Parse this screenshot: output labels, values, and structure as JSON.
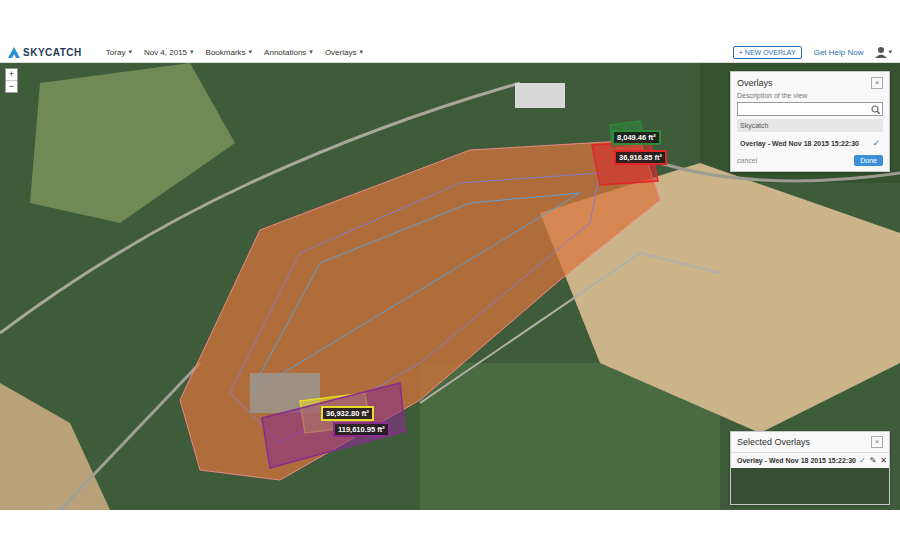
{
  "app": {
    "logo": "SKYCATCH"
  },
  "caret": "▾",
  "menu": [
    {
      "label": "Toray"
    },
    {
      "label": "Nov 4, 2015"
    },
    {
      "label": "Bookmarks"
    },
    {
      "label": "Annotations"
    },
    {
      "label": "Overlays"
    }
  ],
  "header_right": {
    "new_overlay": "+ NEW OVERLAY",
    "help": "Get Help Now"
  },
  "zoom": [
    "+",
    "−"
  ],
  "overlays_panel": {
    "title": "Overlays",
    "subtitle": "Description of the view",
    "close": "×",
    "group": "Skycatch",
    "items": [
      {
        "label": "Overlay - Wed Nov 18 2015 15:22:30",
        "selected": true
      }
    ],
    "check": "✓",
    "cancel": "cancel",
    "done": "Done"
  },
  "selected_panel": {
    "title": "Selected Overlays",
    "close": "×",
    "items": [
      {
        "label": "Overlay - Wed Nov 18 2015 15:22:30",
        "actions": [
          "✓",
          "✎",
          "✕"
        ]
      }
    ]
  },
  "annotations": [
    {
      "label": "8,049.46 ft²",
      "color": "#2f8a3a"
    },
    {
      "label": "36,916.85 ft²",
      "color": "#e0262b"
    },
    {
      "label": "36,932.80 ft²",
      "color": "#e8dc2a"
    },
    {
      "label": "119,610.95 ft²",
      "color": "#8a2c8f"
    }
  ]
}
